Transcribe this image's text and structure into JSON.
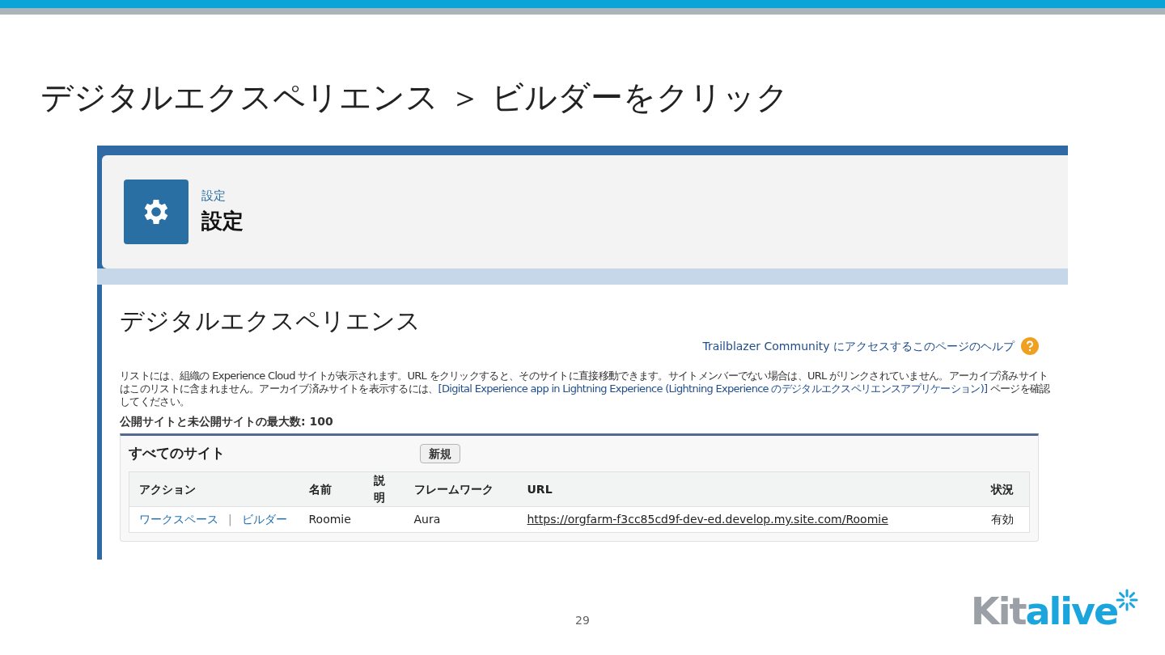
{
  "slide": {
    "title": "デジタルエクスペリエンス ＞ ビルダーをクリック",
    "page_number": "29",
    "logo": {
      "part_1": "Kit",
      "part_2": "alive"
    }
  },
  "header": {
    "breadcrumb": "設定",
    "title": "設定"
  },
  "page": {
    "title": "デジタルエクスペリエンス",
    "help_link": "Trailblazer Community にアクセスするこのページのヘルプ",
    "description": "リストには、組織の Experience Cloud サイトが表示されます。URL をクリックすると、そのサイトに直接移動できます。サイトメンバーでない場合は、URL がリンクされていません。アーカイブ済みサイトはこのリストに含まれません。アーカイブ済みサイトを表示するには、",
    "description_link": "[Digital Experience app in Lightning Experience (Lightning Experience のデジタルエクスペリエンスアプリケーション)]",
    "description_end": " ページを確認してください。",
    "max_sites": "公開サイトと未公開サイトの最大数: 100"
  },
  "sites": {
    "title": "すべてのサイト",
    "new_button": "新規",
    "columns": [
      "アクション",
      "名前",
      "説明",
      "フレームワーク",
      "URL",
      "状況"
    ],
    "rows": [
      {
        "actions": [
          "ワークスペース",
          "ビルダー"
        ],
        "separator": "|",
        "name": "Roomie",
        "framework": "Aura",
        "url": "https://orgfarm-f3cc85cd9f-dev-ed.develop.my.site.com/Roomie",
        "status": "有効"
      }
    ]
  }
}
